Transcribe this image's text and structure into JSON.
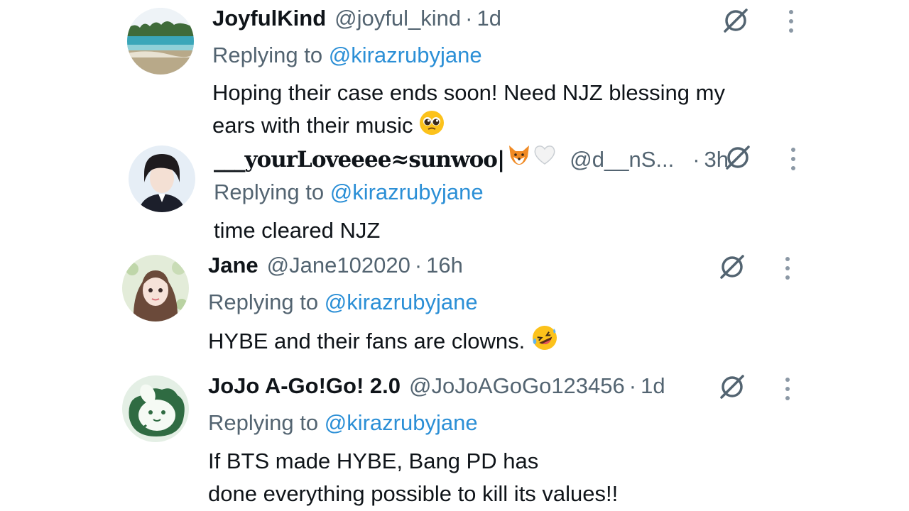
{
  "replying_prefix": "Replying to ",
  "replies": [
    {
      "name": "JoyfulKind",
      "handle": "@joyful_kind",
      "time": "1d",
      "replying_to": "@kirazrubyjane",
      "text_lines": [
        "Hoping their case ends soon! Need NJZ blessing my",
        "ears with their music"
      ],
      "emoji": "pleading-face"
    },
    {
      "name": "___yourLoveeee≈sunwoo|",
      "handle": "@d__nS...",
      "time": "3h",
      "replying_to": "@kirazrubyjane",
      "text_lines": [
        "time cleared NJZ"
      ],
      "name_emojis": [
        "fox-face",
        "white-heart"
      ]
    },
    {
      "name": "Jane",
      "handle": "@Jane102020",
      "time": "16h",
      "replying_to": "@kirazrubyjane",
      "text_lines": [
        "HYBE and their fans are clowns."
      ],
      "emoji": "rolling-on-floor-laughing"
    },
    {
      "name": "JoJo A-Go!Go! 2.0",
      "handle": "@JoJoAGoGo123456",
      "time": "1d",
      "replying_to": "@kirazrubyjane",
      "text_lines": [
        "If BTS made HYBE, Bang PD has",
        "done everything possible to kill its values!!"
      ]
    }
  ],
  "colors": {
    "text": "#0f1419",
    "muted": "#536471",
    "link": "#2b8fd6"
  },
  "icons": {
    "grok": "grok-slash-circle-icon",
    "more": "more-vertical-icon"
  }
}
